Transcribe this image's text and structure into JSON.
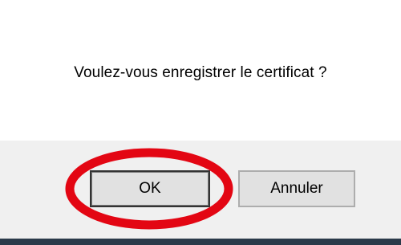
{
  "dialog": {
    "message": "Voulez-vous enregistrer le certificat ?",
    "ok_label": "OK",
    "cancel_label": "Annuler"
  },
  "annotation": {
    "highlight_color": "#e30613",
    "highlight_target": "ok-button"
  },
  "colors": {
    "background": "#ffffff",
    "button_bar": "#f0f0f0",
    "button_face": "#e1e1e1"
  }
}
